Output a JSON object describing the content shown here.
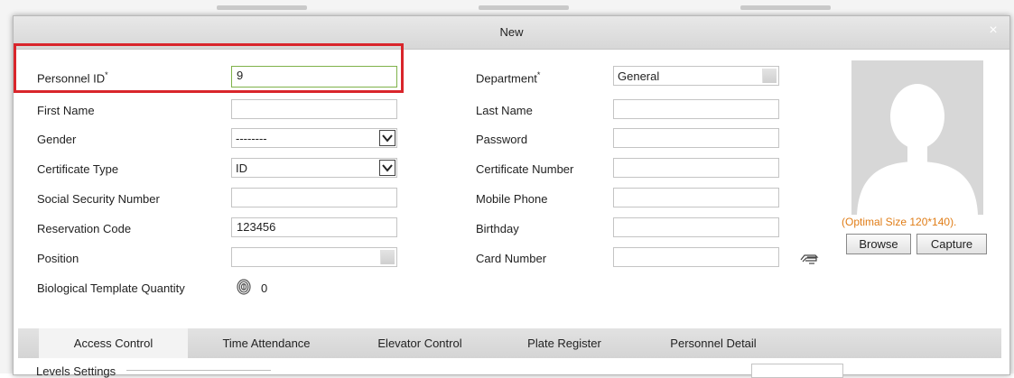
{
  "dialog": {
    "title": "New",
    "close_symbol": "×"
  },
  "form": {
    "personnel_id": {
      "label": "Personnel ID",
      "required_mark": "*",
      "value": "9"
    },
    "first_name": {
      "label": "First Name",
      "value": ""
    },
    "gender": {
      "label": "Gender",
      "value": "--------"
    },
    "certificate_type": {
      "label": "Certificate Type",
      "value": "ID"
    },
    "social_security_number": {
      "label": "Social Security Number",
      "value": ""
    },
    "reservation_code": {
      "label": "Reservation Code",
      "value": "123456"
    },
    "position": {
      "label": "Position",
      "value": ""
    },
    "biological_template_quantity": {
      "label": "Biological Template Quantity",
      "value": "0"
    },
    "department": {
      "label": "Department",
      "required_mark": "*",
      "value": "General"
    },
    "last_name": {
      "label": "Last Name",
      "value": ""
    },
    "password": {
      "label": "Password",
      "value": ""
    },
    "certificate_number": {
      "label": "Certificate Number",
      "value": ""
    },
    "mobile_phone": {
      "label": "Mobile Phone",
      "value": ""
    },
    "birthday": {
      "label": "Birthday",
      "value": ""
    },
    "card_number": {
      "label": "Card Number",
      "value": ""
    }
  },
  "photo": {
    "optimal_size_text": "(Optimal Size 120*140).",
    "browse_label": "Browse",
    "capture_label": "Capture"
  },
  "tabs": [
    {
      "label": "Access Control",
      "active": true
    },
    {
      "label": "Time Attendance",
      "active": false
    },
    {
      "label": "Elevator Control",
      "active": false
    },
    {
      "label": "Plate Register",
      "active": false
    },
    {
      "label": "Personnel Detail",
      "active": false
    }
  ],
  "levels_settings_label": "Levels Settings",
  "colors": {
    "highlight_border": "#d9252b",
    "optimal_text": "#e07d17",
    "active_input_border": "#7fb24a"
  },
  "icons": {
    "close": "close-icon",
    "dropdown": "chevron-down-icon",
    "fingerprint": "fingerprint-icon",
    "card_reader": "card-reader-icon",
    "avatar_placeholder": "person-silhouette-icon"
  }
}
